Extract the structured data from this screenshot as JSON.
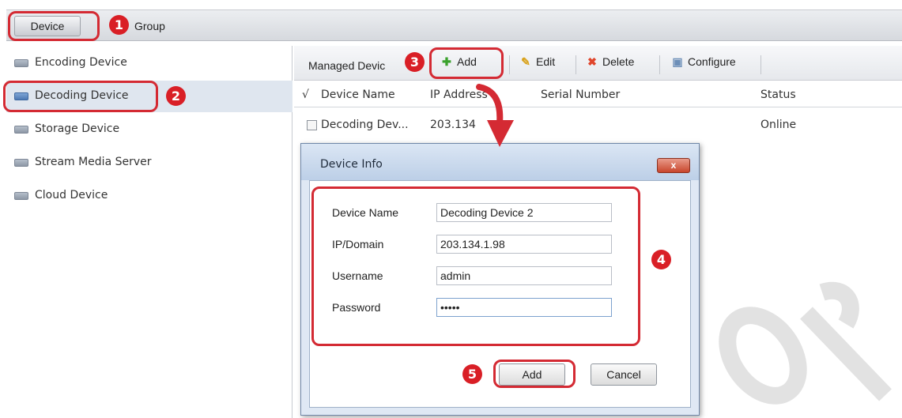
{
  "tabs": {
    "device": "Device",
    "group": "Group"
  },
  "sidebar": {
    "items": [
      {
        "label": "Encoding Device"
      },
      {
        "label": "Decoding Device"
      },
      {
        "label": "Storage Device"
      },
      {
        "label": "Stream Media Server"
      },
      {
        "label": "Cloud Device"
      }
    ]
  },
  "toolbar": {
    "managed_label": "Managed Devic",
    "add": "Add",
    "edit": "Edit",
    "delete": "Delete",
    "configure": "Configure"
  },
  "table": {
    "check_header": "√",
    "headers": [
      "Device Name",
      "IP Address",
      "Serial Number",
      "Status"
    ],
    "rows": [
      {
        "name": "Decoding Dev...",
        "ip": "203.134",
        "serial": "",
        "status": "Online"
      }
    ]
  },
  "dialog": {
    "title": "Device Info",
    "close": "x",
    "fields": [
      {
        "label": "Device Name",
        "value": "Decoding Device 2"
      },
      {
        "label": "IP/Domain",
        "value": "203.134.1.98"
      },
      {
        "label": "Username",
        "value": "admin"
      },
      {
        "label": "Password",
        "value": "•••••"
      }
    ],
    "add": "Add",
    "cancel": "Cancel"
  },
  "annotations": [
    "1",
    "2",
    "3",
    "4",
    "5"
  ],
  "colors": {
    "highlight": "#d42a33",
    "badge": "#d91f26",
    "selected_row": "#dfe6ef"
  }
}
